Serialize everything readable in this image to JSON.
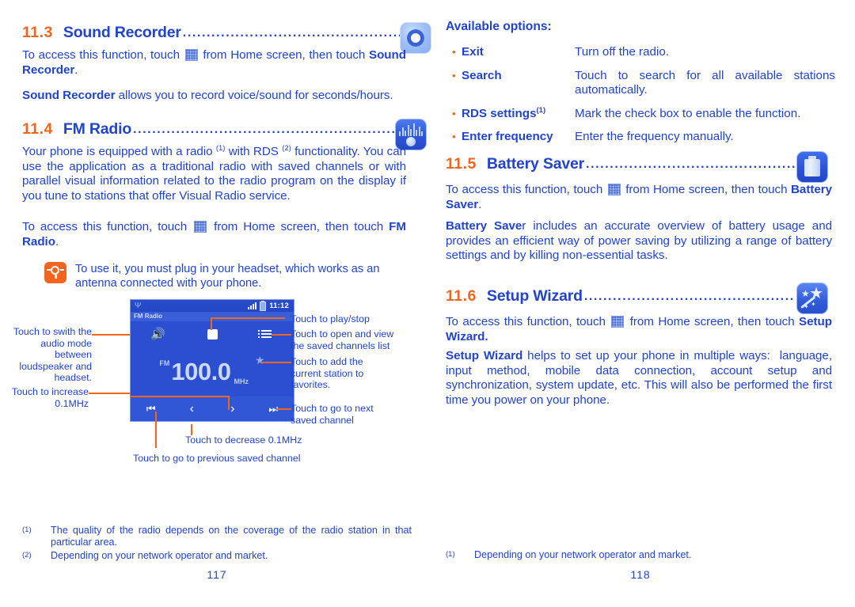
{
  "left_page": {
    "sections": [
      {
        "number": "11.3",
        "title": "Sound Recorder",
        "leader": "................................................................",
        "icon": "sound-recorder-icon",
        "paragraphs": [
          {
            "runs": [
              {
                "t": "To access this function, touch ",
                "b": false
              },
              {
                "t": "[grid]",
                "b": false
              },
              {
                "t": " from Home screen, then touch ",
                "b": false
              },
              {
                "t": "Sound Recorder",
                "b": true
              },
              {
                "t": ".",
                "b": false
              }
            ]
          },
          {
            "runs": [
              {
                "t": "Sound Recorder",
                "b": true
              },
              {
                "t": " allows you to record voice/sound for seconds/hours.",
                "b": false
              }
            ]
          }
        ]
      },
      {
        "number": "11.4",
        "title": "FM Radio",
        "leader": "...........................................................",
        "icon": "fm-radio-icon",
        "paragraphs": [
          {
            "runs": [
              {
                "t": "Your phone is equipped with a radio ",
                "b": false
              },
              {
                "t": "(1)",
                "sup": true
              },
              {
                "t": " with RDS ",
                "b": false
              },
              {
                "t": "(2)",
                "sup": true
              },
              {
                "t": " functionality. You can use the application as a traditional radio with saved channels or with parallel visual information related to the radio program on the display if you tune to stations that offer Visual Radio service.",
                "b": false
              }
            ]
          },
          {
            "runs": [
              {
                "t": "To access this function, touch ",
                "b": false
              },
              {
                "t": "[grid]",
                "b": false
              },
              {
                "t": " from Home screen, then touch ",
                "b": false
              },
              {
                "t": "FM Radio",
                "b": true
              },
              {
                "t": ".",
                "b": false
              }
            ]
          }
        ]
      }
    ],
    "tip": {
      "icon": "tip-bulb-icon",
      "text": "To use it, you must plug in your headset, which works as an antenna connected with your phone."
    },
    "figure": {
      "name": "fm-radio-screen-figure",
      "phone_screen": {
        "status_bar": {
          "usb_icon": "usb-icon",
          "signal_icon": "signal-bars-icon",
          "battery_icon": "battery-icon",
          "clock": "11:12"
        },
        "title_bar": "FM Radio",
        "toolbar": {
          "speaker_icon": "speaker-icon",
          "stop_icon": "stop-icon",
          "channel_list_icon": "channel-list-icon"
        },
        "frequency": {
          "band": "FM",
          "value": "100.0",
          "unit": "MHz",
          "favorite_icon": "star-icon"
        },
        "controls": {
          "prev_saved_icon": "skip-previous-icon",
          "decrease_icon": "chevron-left-icon",
          "increase_icon": "chevron-right-icon",
          "next_saved_icon": "skip-next-icon"
        }
      },
      "callouts": {
        "audio_mode": "Touch to swith the audio mode between loudspeaker and headset.",
        "increase": "Touch to increase 0.1MHz",
        "play_stop": "Touch to play/stop",
        "saved_list": "Touch to open and view the saved channels list",
        "add_favorite": "Touch to add the current station to favorites.",
        "next_channel": "Touch to go to next saved channel",
        "decrease": "Touch to decrease 0.1MHz",
        "previous_channel": "Touch to go to previous saved channel"
      }
    },
    "footnotes": [
      {
        "mark": "(1)",
        "text": "The quality of the radio depends on the coverage of the radio station in that particular area."
      },
      {
        "mark": "(2)",
        "text": "Depending on your network operator and market."
      }
    ],
    "page_number": "117"
  },
  "right_page": {
    "options": {
      "heading": "Available options:",
      "items": [
        {
          "term": "Exit",
          "term_sup": "",
          "desc": "Turn off the radio."
        },
        {
          "term": "Search",
          "term_sup": "",
          "desc": "Touch to search for all available stations automatically."
        },
        {
          "term": "RDS settings",
          "term_sup": "(1)",
          "desc": "Mark the check box to enable the function."
        },
        {
          "term": "Enter frequency",
          "term_sup": "",
          "desc": "Enter the frequency manually."
        }
      ]
    },
    "sections": [
      {
        "number": "11.5",
        "title": "Battery Saver",
        "leader": "..............................................",
        "icon": "battery-saver-icon",
        "paragraphs": [
          {
            "runs": [
              {
                "t": "To access this function, touch ",
                "b": false
              },
              {
                "t": "[grid]",
                "b": false
              },
              {
                "t": " from Home screen, then touch ",
                "b": false
              },
              {
                "t": "Battery Saver",
                "b": true
              },
              {
                "t": ".",
                "b": false
              }
            ]
          },
          {
            "runs": [
              {
                "t": "Battery Save",
                "b": true
              },
              {
                "t": "r includes an accurate overview of battery usage and provides an efficient way of power saving by utilizing a range of battery settings and by killing non-essential tasks.",
                "b": false
              }
            ]
          }
        ]
      },
      {
        "number": "11.6",
        "title": "Setup Wizard",
        "leader": "............................................",
        "icon": "setup-wizard-icon",
        "paragraphs": [
          {
            "runs": [
              {
                "t": "To access this function, touch ",
                "b": false
              },
              {
                "t": "[grid]",
                "b": false
              },
              {
                "t": " from Home screen, then touch ",
                "b": false
              },
              {
                "t": "Setup Wizard.",
                "b": true
              }
            ]
          },
          {
            "runs": [
              {
                "t": "Setup Wizard",
                "b": true
              },
              {
                "t": " helps to set up your phone in multiple ways: language, input method, mobile data connection, account setup and synchronization, system update, etc. This will also be performed the first time you power on your phone.",
                "b": false
              }
            ]
          }
        ]
      }
    ],
    "footnotes": [
      {
        "mark": "(1)",
        "text": "Depending on your network operator and market."
      }
    ],
    "page_number": "118"
  },
  "colors": {
    "text_blue": "#2244cc",
    "accent_orange": "#f2651f",
    "screen_blue": "#2b4fd0"
  }
}
